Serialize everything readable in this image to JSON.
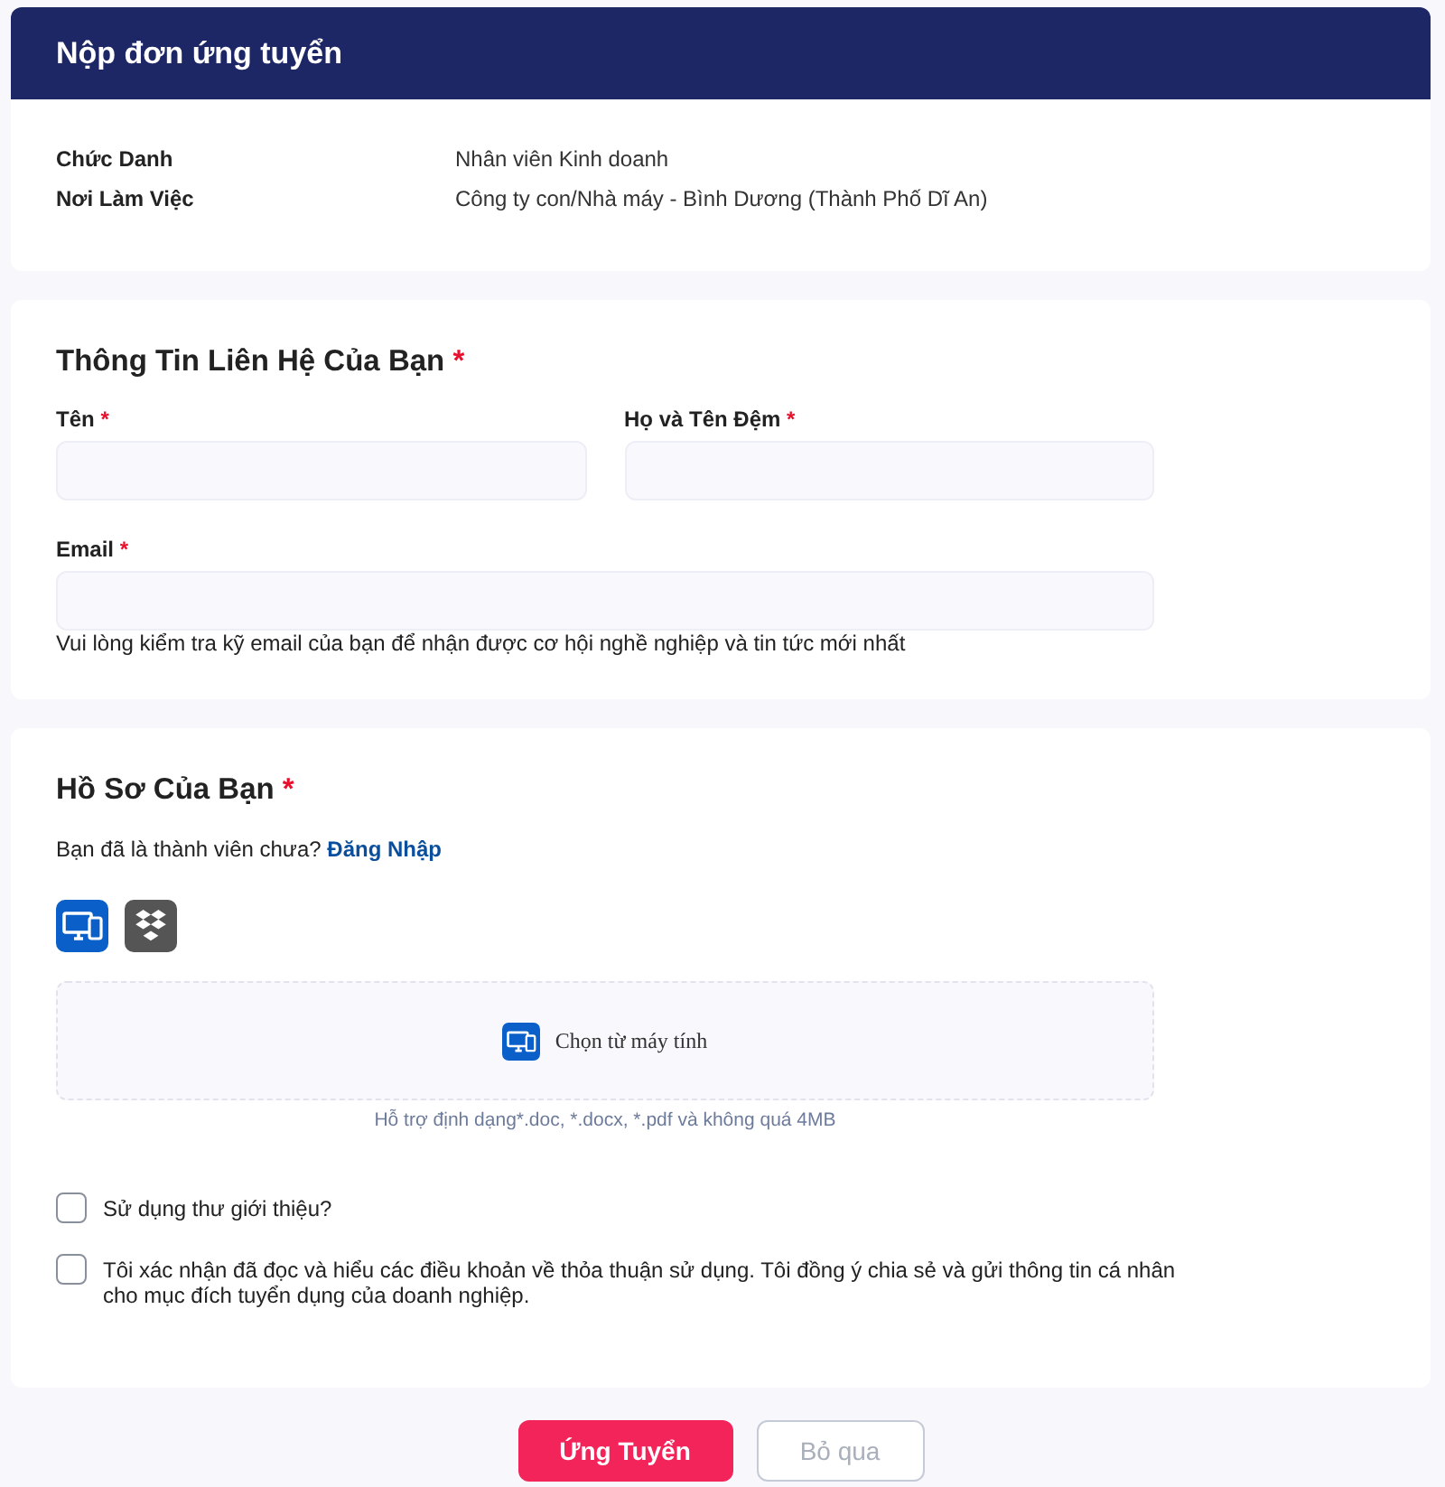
{
  "header": {
    "title": "Nộp đơn ứng tuyển"
  },
  "job_details": [
    {
      "label": "Chức Danh",
      "value": "Nhân viên Kinh doanh"
    },
    {
      "label": "Nơi Làm Việc",
      "value": "Công ty con/Nhà máy - Bình Dương (Thành Phố Dĩ An)"
    }
  ],
  "contact": {
    "title": "Thông Tin Liên Hệ Của Bạn",
    "mark": "*",
    "rows": [
      {
        "fields": [
          {
            "label": "Tên",
            "mark": "*"
          },
          {
            "label": "Họ và Tên Đệm",
            "mark": "*"
          }
        ]
      },
      {
        "fields": [
          {
            "label": "Email",
            "mark": "*",
            "hint": "Vui lòng kiểm tra kỹ email của bạn để nhận được cơ hội nghề nghiệp và tin tức mới nhất"
          }
        ]
      }
    ]
  },
  "resume": {
    "title": "Hồ Sơ Của Bạn",
    "mark": "*",
    "member_prompt": "Bạn đã là thành viên chưa?",
    "login_link": "Đăng Nhập",
    "sources": [
      {
        "kind": "computer",
        "selected": true
      },
      {
        "kind": "dropbox",
        "selected": false
      }
    ],
    "dropzone": {
      "label": "Chọn từ máy tính",
      "hint": "Hỗ trợ định dạng*.doc, *.docx, *.pdf và không quá 4MB"
    },
    "checkboxes": [
      {
        "label": "Sử dụng thư giới thiệu?",
        "checked": false
      },
      {
        "label": "Tôi xác nhận đã đọc và hiểu các điều khoản về thỏa thuận sử dụng. Tôi đồng ý chia sẻ và gửi thông tin cá nhân cho mục đích tuyển dụng của doanh nghiệp.",
        "checked": false
      }
    ]
  },
  "buttons": [
    {
      "label": "Ứng Tuyển",
      "kind": "primary",
      "disabled": false
    },
    {
      "label": "Bỏ qua",
      "kind": "secondary",
      "disabled": true
    }
  ]
}
